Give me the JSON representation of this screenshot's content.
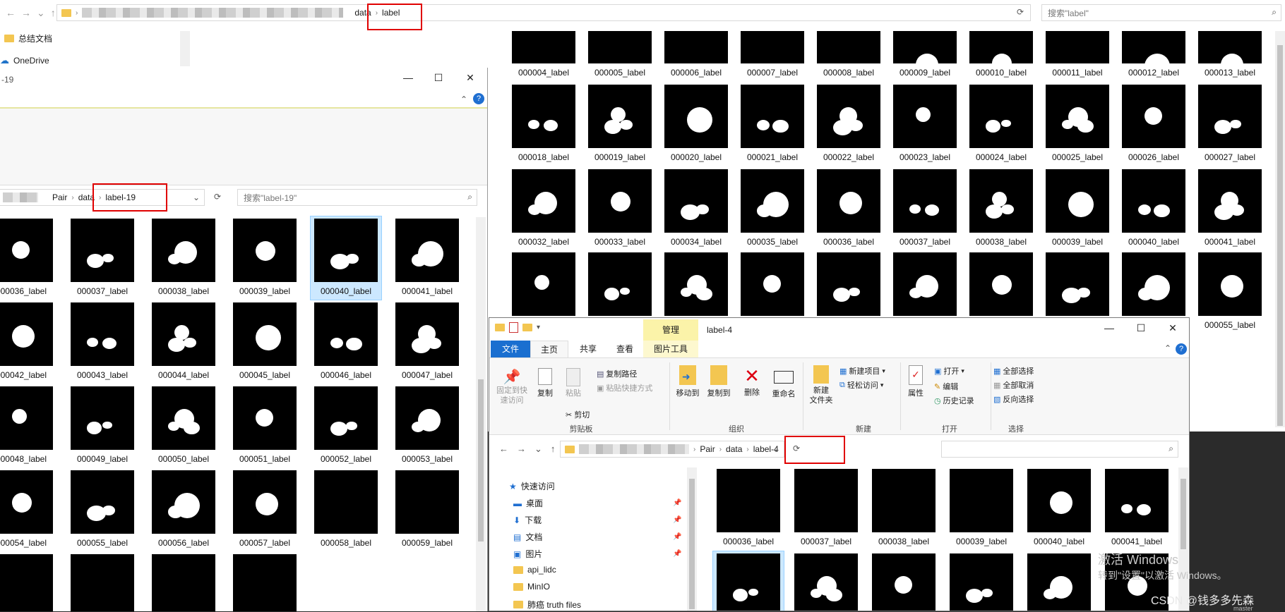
{
  "back_window": {
    "breadcrumb": [
      "data",
      "label"
    ],
    "search_placeholder": "搜索\"label\"",
    "sidebar": [
      {
        "label": "总结文档",
        "icon": "folder-icon"
      },
      {
        "label": "OneDrive",
        "icon": "cloud-icon"
      }
    ],
    "rows": [
      {
        "labels": [
          "000004_label",
          "000005_label",
          "000006_label",
          "000007_label",
          "000008_label",
          "000009_label",
          "000010_label",
          "000011_label",
          "000012_label",
          "000013_label"
        ],
        "partial": "bel"
      },
      {
        "labels": [
          "000018_label",
          "000019_label",
          "000020_label",
          "000021_label",
          "000022_label",
          "000023_label",
          "000024_label",
          "000025_label",
          "000026_label",
          "000027_label"
        ],
        "partial": ""
      },
      {
        "labels": [
          "000032_label",
          "000033_label",
          "000034_label",
          "000035_label",
          "000036_label",
          "000037_label",
          "000038_label",
          "000039_label",
          "000040_label",
          "000041_label"
        ],
        "partial": "bel"
      },
      {
        "labels": [
          "",
          "",
          "",
          "",
          "",
          "",
          "",
          "",
          "",
          "000055_label"
        ],
        "partial": ""
      }
    ]
  },
  "left_window": {
    "title": "-19",
    "breadcrumb": [
      "Pair",
      "data",
      "label-19"
    ],
    "search_placeholder": "搜索\"label-19\"",
    "grid": [
      [
        "000036_label",
        "000037_label",
        "000038_label",
        "000039_label",
        "000040_label",
        "000041_label"
      ],
      [
        "000042_label",
        "000043_label",
        "000044_label",
        "000045_label",
        "000046_label",
        "000047_label"
      ],
      [
        "000048_label",
        "000049_label",
        "000050_label",
        "000051_label",
        "000052_label",
        "000053_label"
      ],
      [
        "000054_label",
        "000055_label",
        "000056_label",
        "000057_label",
        "000058_label",
        "000059_label"
      ],
      [
        "",
        "",
        "",
        ""
      ]
    ],
    "selected": "000040_label"
  },
  "front_window": {
    "title": "label-4",
    "manage_tab": "管理",
    "tabs": [
      "文件",
      "主页",
      "共享",
      "查看",
      "图片工具"
    ],
    "ribbon": {
      "clipboard": {
        "group": "剪贴板",
        "pin": "固定到快\n速访问",
        "copy": "复制",
        "paste": "粘贴",
        "copy_path": "复制路径",
        "paste_shortcut": "粘贴快捷方式",
        "cut": "剪切"
      },
      "organize": {
        "group": "组织",
        "move_to": "移动到",
        "copy_to": "复制到",
        "delete": "删除",
        "rename": "重命名"
      },
      "new": {
        "group": "新建",
        "new_folder": "新建\n文件夹",
        "new_item": "新建项目",
        "easy_access": "轻松访问"
      },
      "open": {
        "group": "打开",
        "properties": "属性",
        "open": "打开",
        "edit": "编辑",
        "history": "历史记录"
      },
      "select": {
        "group": "选择",
        "select_all": "全部选择",
        "select_none": "全部取消",
        "invert": "反向选择"
      }
    },
    "breadcrumb": [
      "Pair",
      "data",
      "label-4"
    ],
    "nav": [
      {
        "label": "快速访问",
        "icon": "star-icon",
        "pinned": false
      },
      {
        "label": "桌面",
        "icon": "desktop-icon",
        "pinned": true
      },
      {
        "label": "下载",
        "icon": "download-icon",
        "pinned": true
      },
      {
        "label": "文档",
        "icon": "document-icon",
        "pinned": true
      },
      {
        "label": "图片",
        "icon": "picture-icon",
        "pinned": true
      },
      {
        "label": "api_lidc",
        "icon": "folder-icon",
        "pinned": false
      },
      {
        "label": "MinIO",
        "icon": "folder-icon",
        "pinned": false
      },
      {
        "label": "肺癌 truth files",
        "icon": "folder-icon",
        "pinned": false
      }
    ],
    "grid_labels": [
      "000036_label",
      "000037_label",
      "000038_label",
      "000039_label",
      "000040_label",
      "000041_label"
    ]
  },
  "watermark": {
    "line1": "激活 Windows",
    "line2": "转到\"设置\"以激活 Windows。",
    "csdn": "CSDN @钱多多先森",
    "git": "master"
  }
}
